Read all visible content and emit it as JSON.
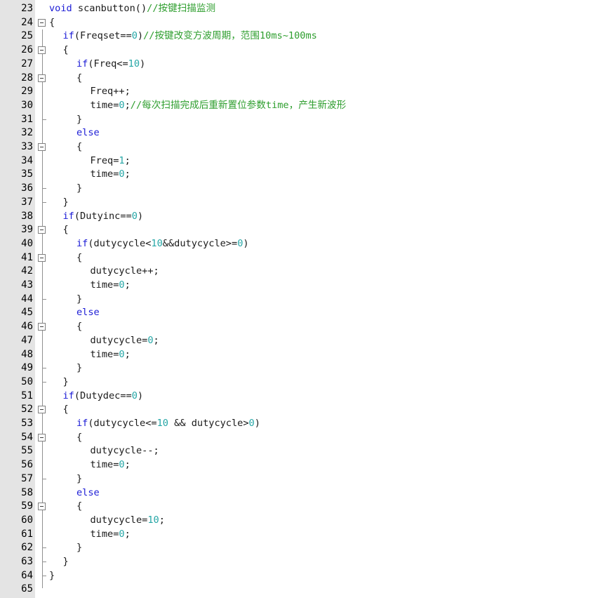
{
  "editor": {
    "language": "C",
    "colors": {
      "keyword": "#1c1cd6",
      "number": "#25a6a6",
      "comment": "#2e9e2e",
      "text": "#1a1a1a",
      "gutter": "#e4e4e4"
    },
    "lines": [
      {
        "num": "23",
        "indent": 0,
        "fold": "none",
        "tokens": [
          {
            "t": "kw",
            "v": "void"
          },
          {
            "t": "txt",
            "v": " scanbutton()"
          },
          {
            "t": "cmt",
            "v": "//按键扫描监测"
          }
        ]
      },
      {
        "num": "24",
        "indent": 0,
        "fold": "open",
        "tokens": [
          {
            "t": "txt",
            "v": "{"
          }
        ]
      },
      {
        "num": "25",
        "indent": 1,
        "fold": "none",
        "tokens": [
          {
            "t": "kw",
            "v": "if"
          },
          {
            "t": "txt",
            "v": "(Freqset=="
          },
          {
            "t": "num",
            "v": "0"
          },
          {
            "t": "txt",
            "v": ")"
          },
          {
            "t": "cmt",
            "v": "//按键改变方波周期，范围10ms~100ms"
          }
        ]
      },
      {
        "num": "26",
        "indent": 1,
        "fold": "open",
        "tokens": [
          {
            "t": "txt",
            "v": "{"
          }
        ]
      },
      {
        "num": "27",
        "indent": 2,
        "fold": "none",
        "tokens": [
          {
            "t": "kw",
            "v": "if"
          },
          {
            "t": "txt",
            "v": "(Freq<="
          },
          {
            "t": "num",
            "v": "10"
          },
          {
            "t": "txt",
            "v": ")"
          }
        ]
      },
      {
        "num": "28",
        "indent": 2,
        "fold": "open",
        "tokens": [
          {
            "t": "txt",
            "v": "{"
          }
        ]
      },
      {
        "num": "29",
        "indent": 3,
        "fold": "none",
        "tokens": [
          {
            "t": "txt",
            "v": "Freq++;"
          }
        ]
      },
      {
        "num": "30",
        "indent": 3,
        "fold": "none",
        "tokens": [
          {
            "t": "txt",
            "v": "time="
          },
          {
            "t": "num",
            "v": "0"
          },
          {
            "t": "txt",
            "v": ";"
          },
          {
            "t": "cmt",
            "v": "//每次扫描完成后重新置位参数time，产生新波形"
          }
        ]
      },
      {
        "num": "31",
        "indent": 2,
        "fold": "end",
        "tokens": [
          {
            "t": "txt",
            "v": "}"
          }
        ]
      },
      {
        "num": "32",
        "indent": 2,
        "fold": "none",
        "tokens": [
          {
            "t": "kw",
            "v": "else"
          }
        ]
      },
      {
        "num": "33",
        "indent": 2,
        "fold": "open",
        "tokens": [
          {
            "t": "txt",
            "v": "{"
          }
        ]
      },
      {
        "num": "34",
        "indent": 3,
        "fold": "none",
        "tokens": [
          {
            "t": "txt",
            "v": "Freq="
          },
          {
            "t": "num",
            "v": "1"
          },
          {
            "t": "txt",
            "v": ";"
          }
        ]
      },
      {
        "num": "35",
        "indent": 3,
        "fold": "none",
        "tokens": [
          {
            "t": "txt",
            "v": "time="
          },
          {
            "t": "num",
            "v": "0"
          },
          {
            "t": "txt",
            "v": ";"
          }
        ]
      },
      {
        "num": "36",
        "indent": 2,
        "fold": "end",
        "tokens": [
          {
            "t": "txt",
            "v": "}"
          }
        ]
      },
      {
        "num": "37",
        "indent": 1,
        "fold": "end",
        "tokens": [
          {
            "t": "txt",
            "v": "}"
          }
        ]
      },
      {
        "num": "38",
        "indent": 1,
        "fold": "none",
        "tokens": [
          {
            "t": "kw",
            "v": "if"
          },
          {
            "t": "txt",
            "v": "(Dutyinc=="
          },
          {
            "t": "num",
            "v": "0"
          },
          {
            "t": "txt",
            "v": ")"
          }
        ]
      },
      {
        "num": "39",
        "indent": 1,
        "fold": "open",
        "tokens": [
          {
            "t": "txt",
            "v": "{"
          }
        ]
      },
      {
        "num": "40",
        "indent": 2,
        "fold": "none",
        "tokens": [
          {
            "t": "kw",
            "v": "if"
          },
          {
            "t": "txt",
            "v": "(dutycycle<"
          },
          {
            "t": "num",
            "v": "10"
          },
          {
            "t": "txt",
            "v": "&&dutycycle>="
          },
          {
            "t": "num",
            "v": "0"
          },
          {
            "t": "txt",
            "v": ")"
          }
        ]
      },
      {
        "num": "41",
        "indent": 2,
        "fold": "open",
        "tokens": [
          {
            "t": "txt",
            "v": "{"
          }
        ]
      },
      {
        "num": "42",
        "indent": 3,
        "fold": "none",
        "tokens": [
          {
            "t": "txt",
            "v": "dutycycle++;"
          }
        ]
      },
      {
        "num": "43",
        "indent": 3,
        "fold": "none",
        "tokens": [
          {
            "t": "txt",
            "v": "time="
          },
          {
            "t": "num",
            "v": "0"
          },
          {
            "t": "txt",
            "v": ";"
          }
        ]
      },
      {
        "num": "44",
        "indent": 2,
        "fold": "end",
        "tokens": [
          {
            "t": "txt",
            "v": "}"
          }
        ]
      },
      {
        "num": "45",
        "indent": 2,
        "fold": "none",
        "tokens": [
          {
            "t": "kw",
            "v": "else"
          }
        ]
      },
      {
        "num": "46",
        "indent": 2,
        "fold": "open",
        "tokens": [
          {
            "t": "txt",
            "v": "{"
          }
        ]
      },
      {
        "num": "47",
        "indent": 3,
        "fold": "none",
        "tokens": [
          {
            "t": "txt",
            "v": "dutycycle="
          },
          {
            "t": "num",
            "v": "0"
          },
          {
            "t": "txt",
            "v": ";"
          }
        ]
      },
      {
        "num": "48",
        "indent": 3,
        "fold": "none",
        "tokens": [
          {
            "t": "txt",
            "v": "time="
          },
          {
            "t": "num",
            "v": "0"
          },
          {
            "t": "txt",
            "v": ";"
          }
        ]
      },
      {
        "num": "49",
        "indent": 2,
        "fold": "end",
        "tokens": [
          {
            "t": "txt",
            "v": "}"
          }
        ]
      },
      {
        "num": "50",
        "indent": 1,
        "fold": "end",
        "tokens": [
          {
            "t": "txt",
            "v": "}"
          }
        ]
      },
      {
        "num": "51",
        "indent": 1,
        "fold": "none",
        "tokens": [
          {
            "t": "kw",
            "v": "if"
          },
          {
            "t": "txt",
            "v": "(Dutydec=="
          },
          {
            "t": "num",
            "v": "0"
          },
          {
            "t": "txt",
            "v": ")"
          }
        ]
      },
      {
        "num": "52",
        "indent": 1,
        "fold": "open",
        "tokens": [
          {
            "t": "txt",
            "v": "{"
          }
        ]
      },
      {
        "num": "53",
        "indent": 2,
        "fold": "none",
        "tokens": [
          {
            "t": "kw",
            "v": "if"
          },
          {
            "t": "txt",
            "v": "(dutycycle<="
          },
          {
            "t": "num",
            "v": "10"
          },
          {
            "t": "txt",
            "v": " && dutycycle>"
          },
          {
            "t": "num",
            "v": "0"
          },
          {
            "t": "txt",
            "v": ")"
          }
        ]
      },
      {
        "num": "54",
        "indent": 2,
        "fold": "open",
        "tokens": [
          {
            "t": "txt",
            "v": "{"
          }
        ]
      },
      {
        "num": "55",
        "indent": 3,
        "fold": "none",
        "tokens": [
          {
            "t": "txt",
            "v": "dutycycle--;"
          }
        ]
      },
      {
        "num": "56",
        "indent": 3,
        "fold": "none",
        "tokens": [
          {
            "t": "txt",
            "v": "time="
          },
          {
            "t": "num",
            "v": "0"
          },
          {
            "t": "txt",
            "v": ";"
          }
        ]
      },
      {
        "num": "57",
        "indent": 2,
        "fold": "end",
        "tokens": [
          {
            "t": "txt",
            "v": "}"
          }
        ]
      },
      {
        "num": "58",
        "indent": 2,
        "fold": "none",
        "tokens": [
          {
            "t": "kw",
            "v": "else"
          }
        ]
      },
      {
        "num": "59",
        "indent": 2,
        "fold": "open",
        "tokens": [
          {
            "t": "txt",
            "v": "{"
          }
        ]
      },
      {
        "num": "60",
        "indent": 3,
        "fold": "none",
        "tokens": [
          {
            "t": "txt",
            "v": "dutycycle="
          },
          {
            "t": "num",
            "v": "10"
          },
          {
            "t": "txt",
            "v": ";"
          }
        ]
      },
      {
        "num": "61",
        "indent": 3,
        "fold": "none",
        "tokens": [
          {
            "t": "txt",
            "v": "time="
          },
          {
            "t": "num",
            "v": "0"
          },
          {
            "t": "txt",
            "v": ";"
          }
        ]
      },
      {
        "num": "62",
        "indent": 2,
        "fold": "end",
        "tokens": [
          {
            "t": "txt",
            "v": "}"
          }
        ]
      },
      {
        "num": "63",
        "indent": 1,
        "fold": "end",
        "tokens": [
          {
            "t": "txt",
            "v": "}"
          }
        ]
      },
      {
        "num": "64",
        "indent": 0,
        "fold": "end",
        "tokens": [
          {
            "t": "txt",
            "v": "}"
          }
        ]
      },
      {
        "num": "65",
        "indent": 0,
        "fold": "none",
        "tokens": []
      }
    ]
  }
}
